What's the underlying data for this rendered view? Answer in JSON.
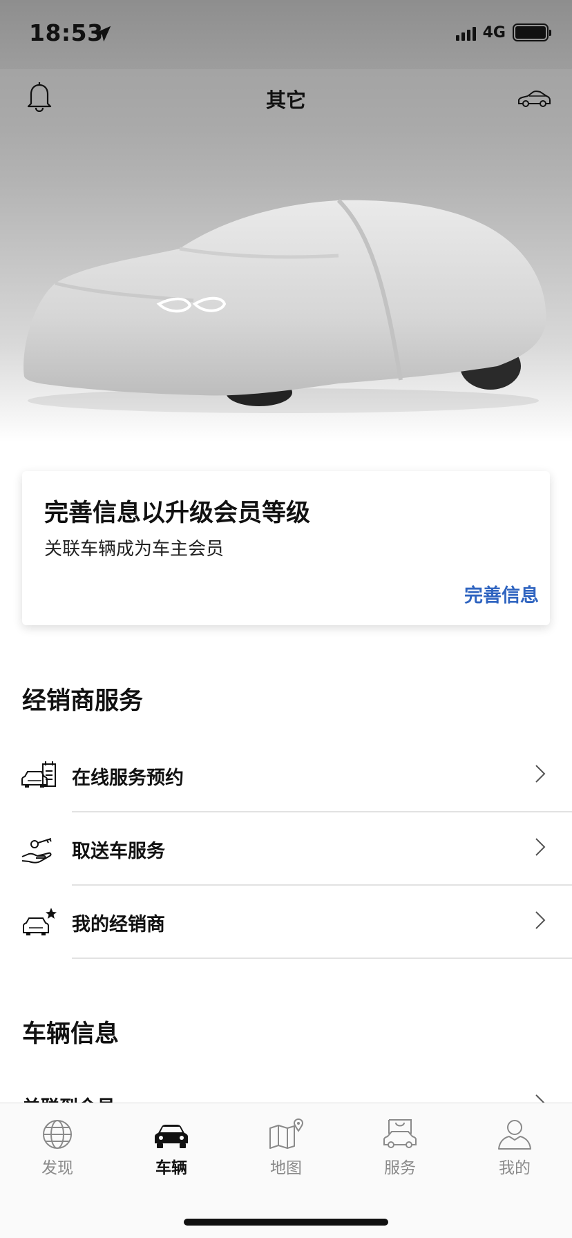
{
  "status_bar": {
    "time": "18:53",
    "network": "4G"
  },
  "nav": {
    "title": "其它"
  },
  "card": {
    "title": "完善信息以升级会员等级",
    "subtitle": "关联车辆成为车主会员",
    "action": "完善信息"
  },
  "dealer_section": {
    "title": "经销商服务",
    "items": [
      {
        "label": "在线服务预约",
        "icon": "car-calendar-icon"
      },
      {
        "label": "取送车服务",
        "icon": "hand-key-icon"
      },
      {
        "label": "我的经销商",
        "icon": "car-star-icon"
      }
    ]
  },
  "vehicle_section": {
    "title": "车辆信息",
    "items": [
      {
        "label": "关联到会员"
      }
    ]
  },
  "tab_bar": {
    "tabs": [
      {
        "label": "发现",
        "icon": "globe-icon",
        "active": false
      },
      {
        "label": "车辆",
        "icon": "car-front-icon",
        "active": true
      },
      {
        "label": "地图",
        "icon": "map-pin-icon",
        "active": false
      },
      {
        "label": "服务",
        "icon": "shopping-car-icon",
        "active": false
      },
      {
        "label": "我的",
        "icon": "person-icon",
        "active": false
      }
    ]
  },
  "colors": {
    "accent": "#2f64c0",
    "text": "#111111",
    "inactive_tab": "#8a8a8a"
  }
}
